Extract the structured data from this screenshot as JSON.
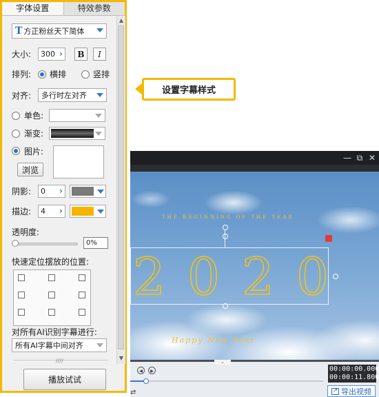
{
  "panel": {
    "tabs": [
      {
        "label": "字体设置",
        "active": true
      },
      {
        "label": "特效参数",
        "active": false
      }
    ],
    "font": {
      "selected": "方正粉丝天下简体",
      "icon": "font-T-icon"
    },
    "size": {
      "label": "大小:",
      "value": "300",
      "bold": "B",
      "italic": "I"
    },
    "arrange": {
      "label": "排列:",
      "options": [
        "横排",
        "竖排"
      ],
      "selected": "横排"
    },
    "align": {
      "label": "对齐:",
      "selected": "多行时左对齐"
    },
    "fill": {
      "solid_label": "单色:",
      "gradient_label": "渐变:",
      "image_label": "图片:",
      "selected": "图片",
      "browse_label": "浏览"
    },
    "shadow": {
      "label": "阴影:",
      "value": "0",
      "color": "#7a7a7a"
    },
    "stroke": {
      "label": "描边:",
      "value": "4",
      "color": "#f7b500"
    },
    "opacity": {
      "label": "透明度:",
      "value": "0%",
      "level": 0
    },
    "quick_position": {
      "label": "快速定位摆放的位置:"
    },
    "ai": {
      "label": "对所有AI识别字幕进行:",
      "selected": "所有AI字幕中间对齐"
    },
    "play_button": "播放试试"
  },
  "callout": {
    "text": "设置字幕样式"
  },
  "preview": {
    "window_controls": [
      "—",
      "⧉",
      "✕"
    ],
    "tagline": "THE BEGINNING OF THE YEAR",
    "year_digits": [
      "2",
      "0",
      "2",
      "0"
    ],
    "script_line": "Happy New Year",
    "current_time": "00:00:00.000",
    "total_time": "00:00:11.800",
    "export_label": "导出视频",
    "progress": 0.08
  },
  "colors": {
    "accent": "#f5b800",
    "blue": "#3a78c9"
  }
}
